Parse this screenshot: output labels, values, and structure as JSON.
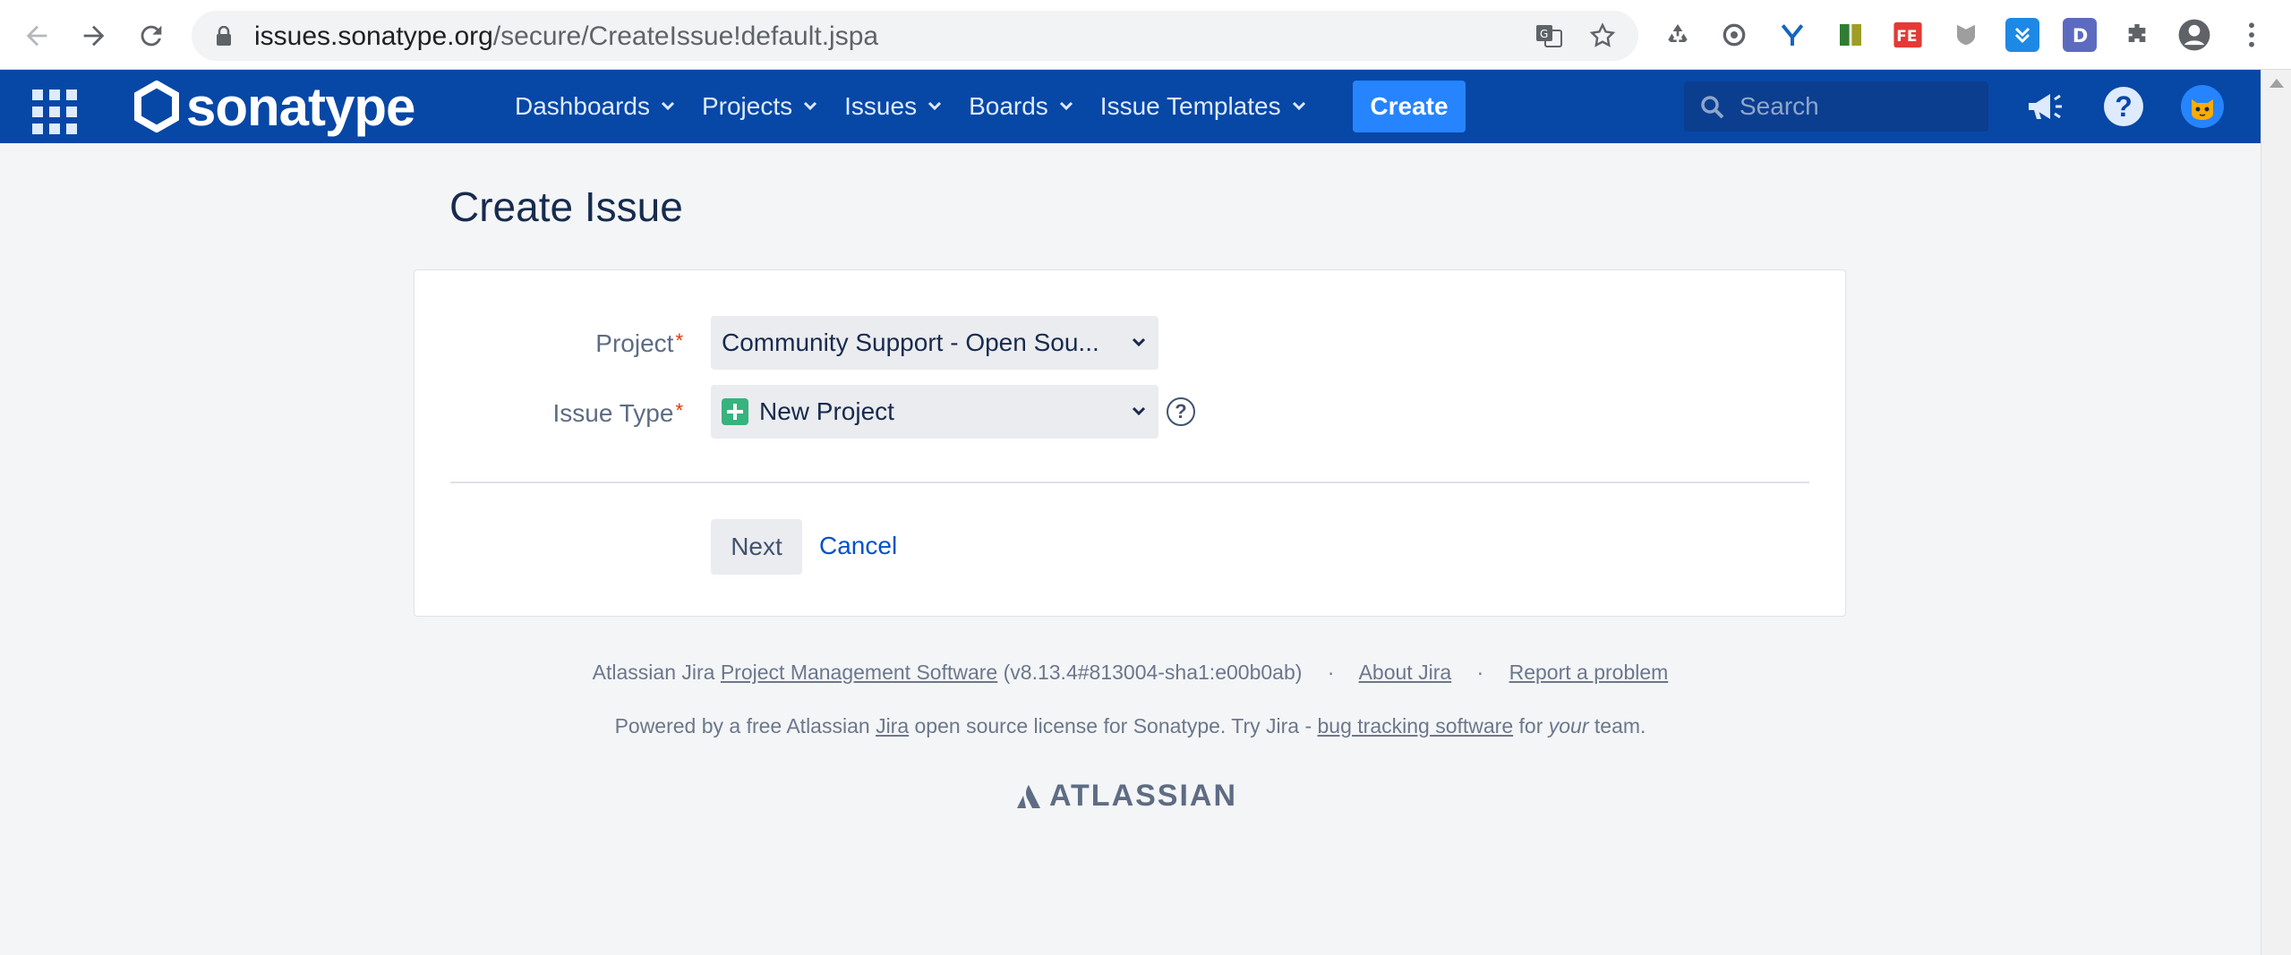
{
  "browser": {
    "url_host": "issues.sonatype.org",
    "url_path": "/secure/CreateIssue!default.jspa"
  },
  "header": {
    "logo_text": "sonatype",
    "menu": [
      {
        "label": "Dashboards"
      },
      {
        "label": "Projects"
      },
      {
        "label": "Issues"
      },
      {
        "label": "Boards"
      },
      {
        "label": "Issue Templates"
      }
    ],
    "create_label": "Create",
    "search_placeholder": "Search"
  },
  "page": {
    "title": "Create Issue"
  },
  "form": {
    "project_label": "Project",
    "project_value": "Community Support - Open Sou...",
    "issue_type_label": "Issue Type",
    "issue_type_value": "New Project",
    "required_mark": "*",
    "help_glyph": "?",
    "next_label": "Next",
    "cancel_label": "Cancel"
  },
  "footer": {
    "line1_prefix": "Atlassian Jira",
    "line1_link": "Project Management Software",
    "line1_version": "(v8.13.4#813004-sha1:e00b0ab)",
    "sep": "·",
    "about_link": "About Jira",
    "report_link": "Report a problem",
    "line2_a": "Powered by a free Atlassian",
    "line2_jira_link": "Jira",
    "line2_b": "open source license for Sonatype. Try Jira -",
    "line2_bug_link": "bug tracking software",
    "line2_c": "for",
    "line2_your": "your",
    "line2_d": "team.",
    "atlassian_logo": "ATLASSIAN"
  },
  "colors": {
    "header_bg": "#0747a6",
    "create_bg": "#2684ff",
    "link": "#0052cc",
    "required": "#de350b",
    "issue_type_icon": "#36b37e"
  }
}
